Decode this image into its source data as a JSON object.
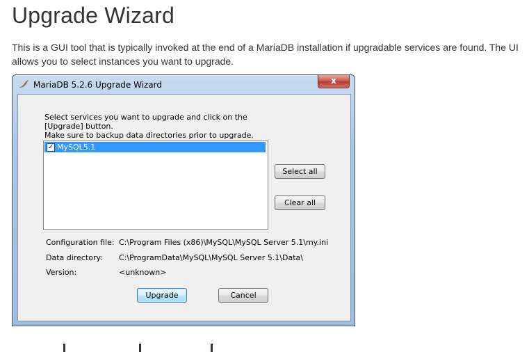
{
  "page": {
    "title": "Upgrade Wizard",
    "intro": "This is a GUI tool that is typically invoked at the end of a MariaDB installation if upgradable services are found. The UI allows you to select instances you want to upgrade."
  },
  "window": {
    "title": "MariaDB 5.2.6 Upgrade Wizard",
    "close_label": "x"
  },
  "dialog": {
    "instructions_line1": "Select services you want to upgrade and click on the [Upgrade] button.",
    "instructions_line2": "Make sure to backup data directories prior to upgrade.",
    "services": [
      {
        "name": "MySQL5.1",
        "checked": true,
        "selected": true
      }
    ],
    "select_all_label": "Select all",
    "clear_all_label": "Clear all",
    "config_file_label": "Configuration file:",
    "config_file_value": "C:\\Program Files (x86)\\MySQL\\MySQL Server 5.1\\my.ini",
    "data_directory_label": "Data directory:",
    "data_directory_value": "C:\\ProgramData\\MySQL\\MySQL Server 5.1\\Data\\",
    "version_label": "Version:",
    "version_value": "<unknown>",
    "upgrade_label": "Upgrade",
    "cancel_label": "Cancel"
  },
  "colors": {
    "selection": "#3399ff",
    "window_frame": "#a9c5e4",
    "close_button": "#c75050"
  }
}
